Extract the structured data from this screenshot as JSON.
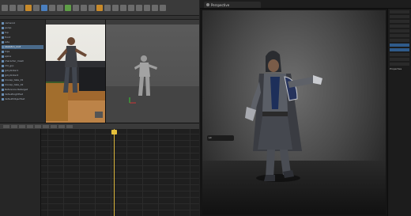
{
  "maya": {
    "outliner_items": [
      "camera1",
      "persp",
      "top",
      "front",
      "side",
      "skeleton_root",
      "hips",
      "spine",
      "character_mesh",
      "ctrl_grp",
      "|pCylinder1",
      "|pCylinder2",
      "mocap_take_01",
      "mocap_take_02",
      "Reference Retarget",
      "defaultLightSet",
      "defaultObjectSet"
    ],
    "selected_index": 5,
    "playhead_frame_fraction": 0.57
  },
  "unreal": {
    "viewport_tab": "Perspective",
    "viewport_mode": "Lit",
    "details_header": "Properties"
  },
  "colors": {
    "accent_gold": "#e5c03b",
    "selection_blue": "#2f5a8a"
  }
}
